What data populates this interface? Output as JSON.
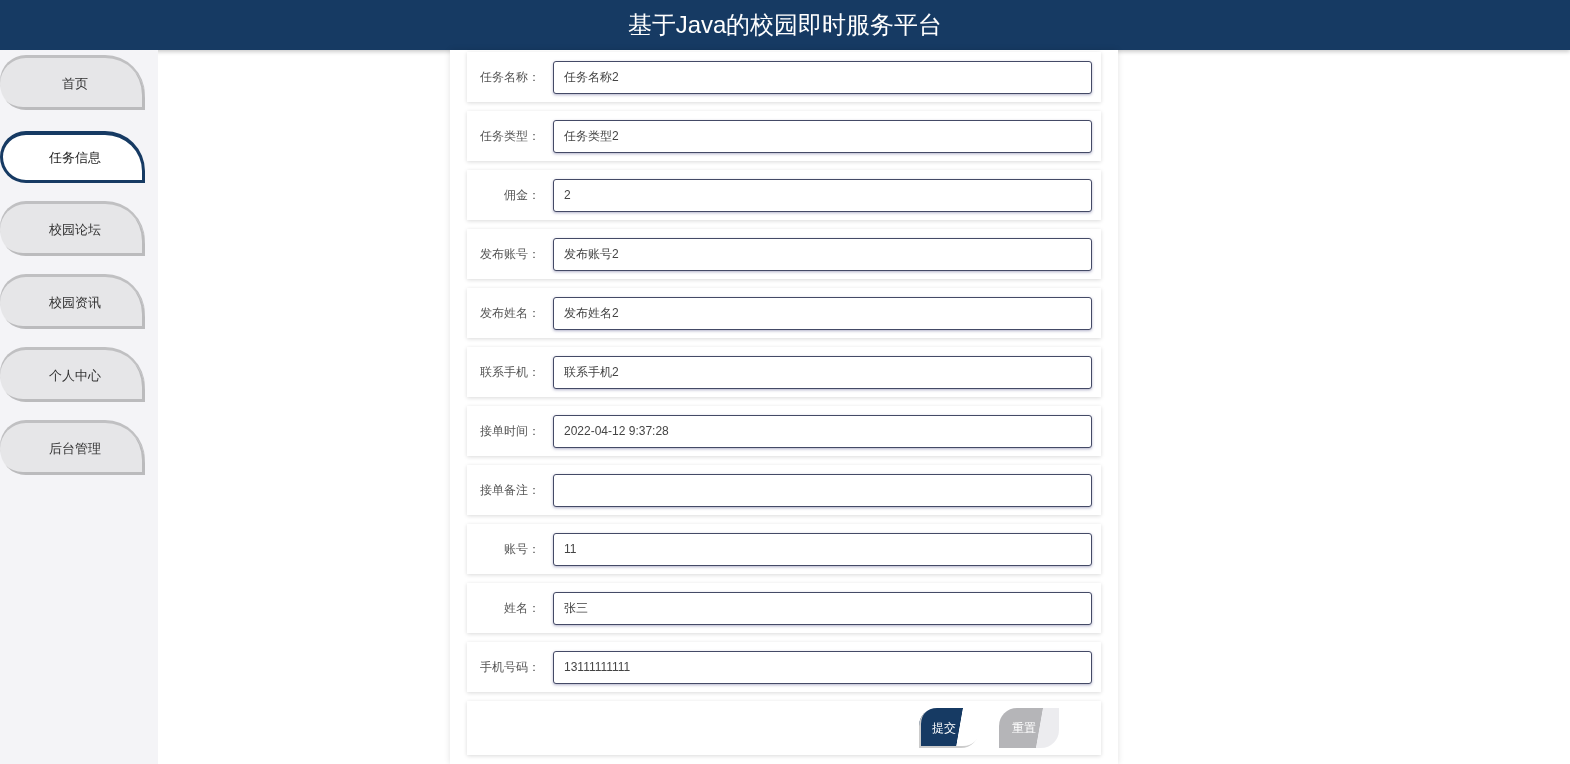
{
  "header": {
    "title": "基于Java的校园即时服务平台"
  },
  "sidebar": {
    "items": [
      {
        "label": "首页",
        "selected": false
      },
      {
        "label": "任务信息",
        "selected": true
      },
      {
        "label": "校园论坛",
        "selected": false
      },
      {
        "label": "校园资讯",
        "selected": false
      },
      {
        "label": "个人中心",
        "selected": false
      },
      {
        "label": "后台管理",
        "selected": false
      }
    ]
  },
  "form": {
    "fields": [
      {
        "label": "任务名称：",
        "value": "任务名称2"
      },
      {
        "label": "任务类型：",
        "value": "任务类型2"
      },
      {
        "label": "佣金：",
        "value": "2"
      },
      {
        "label": "发布账号：",
        "value": "发布账号2"
      },
      {
        "label": "发布姓名：",
        "value": "发布姓名2"
      },
      {
        "label": "联系手机：",
        "value": "联系手机2"
      },
      {
        "label": "接单时间：",
        "value": "2022-04-12 9:37:28"
      },
      {
        "label": "接单备注："
      },
      {
        "label": "账号：",
        "value": "11"
      },
      {
        "label": "姓名：",
        "value": "张三"
      },
      {
        "label": "手机号码：",
        "value": "13111111111"
      }
    ],
    "buttons": [
      {
        "label": "提交",
        "kind": "primary"
      },
      {
        "label": "重置",
        "kind": "secondary"
      }
    ]
  }
}
